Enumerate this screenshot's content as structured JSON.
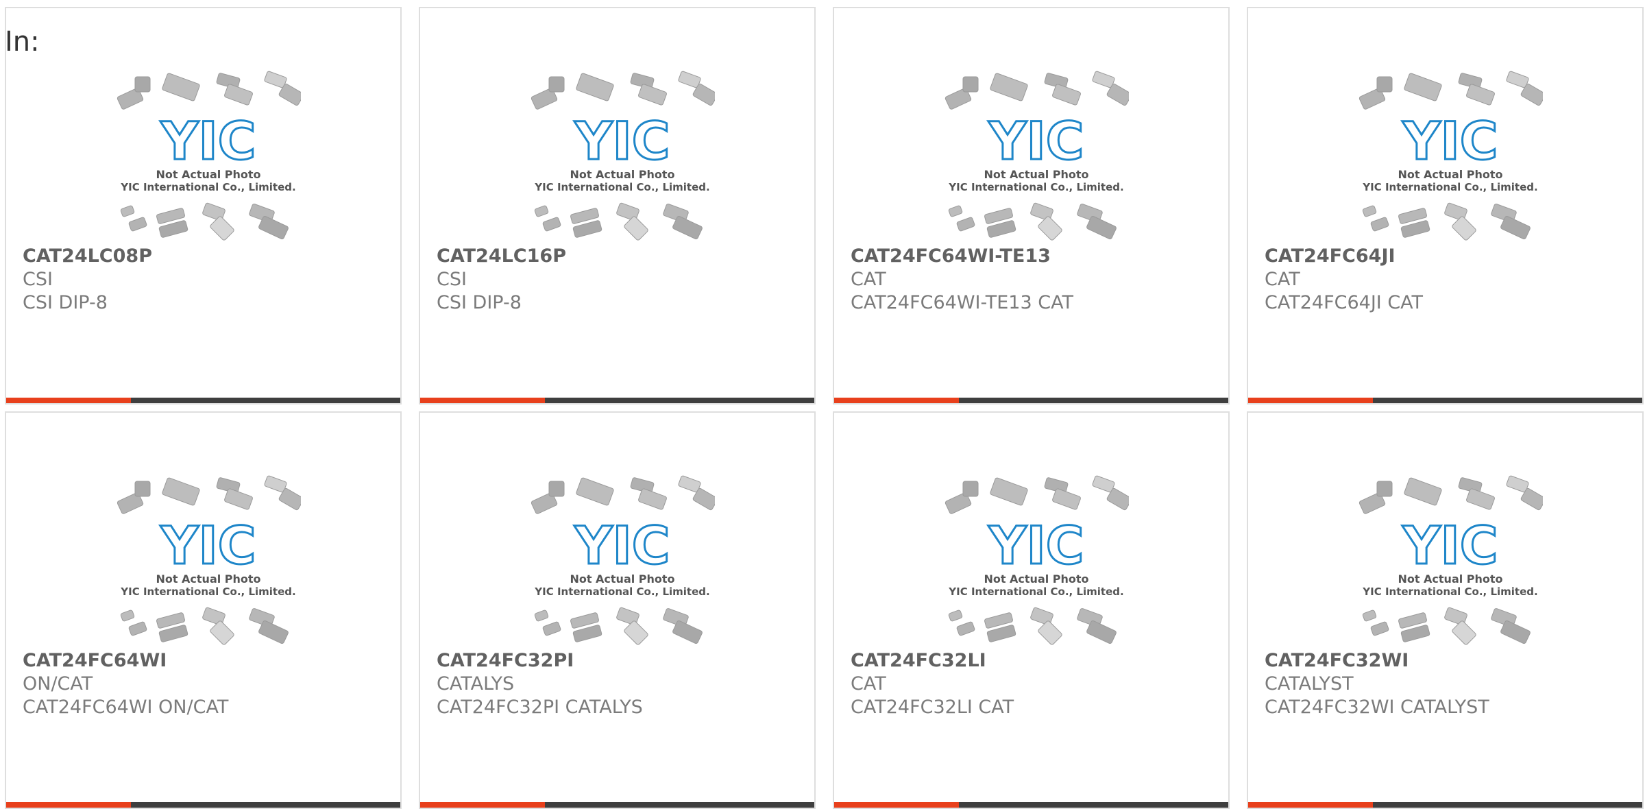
{
  "in_label": "In:",
  "placeholder": {
    "logo_text": "YIC",
    "caption_line1": "Not Actual Photo",
    "caption_line2": "YIC International Co., Limited."
  },
  "colors": {
    "accent": "#e8401c",
    "bar": "#3f3f3f",
    "logo": "#1e86c9",
    "text_primary": "#616161",
    "text_secondary": "#7b7b7b",
    "border": "#dedede"
  },
  "products": [
    {
      "part_no": "CAT24LC08P",
      "maker": "CSI",
      "desc": "CSI DIP-8"
    },
    {
      "part_no": "CAT24LC16P",
      "maker": "CSI",
      "desc": "CSI DIP-8"
    },
    {
      "part_no": "CAT24FC64WI-TE13",
      "maker": "CAT",
      "desc": "CAT24FC64WI-TE13 CAT"
    },
    {
      "part_no": "CAT24FC64JI",
      "maker": "CAT",
      "desc": "CAT24FC64JI CAT"
    },
    {
      "part_no": "CAT24FC64WI",
      "maker": "ON/CAT",
      "desc": "CAT24FC64WI ON/CAT"
    },
    {
      "part_no": "CAT24FC32PI",
      "maker": "CATALYS",
      "desc": "CAT24FC32PI CATALYS"
    },
    {
      "part_no": "CAT24FC32LI",
      "maker": "CAT",
      "desc": "CAT24FC32LI CAT"
    },
    {
      "part_no": "CAT24FC32WI",
      "maker": "CATALYST",
      "desc": "CAT24FC32WI CATALYST"
    }
  ]
}
